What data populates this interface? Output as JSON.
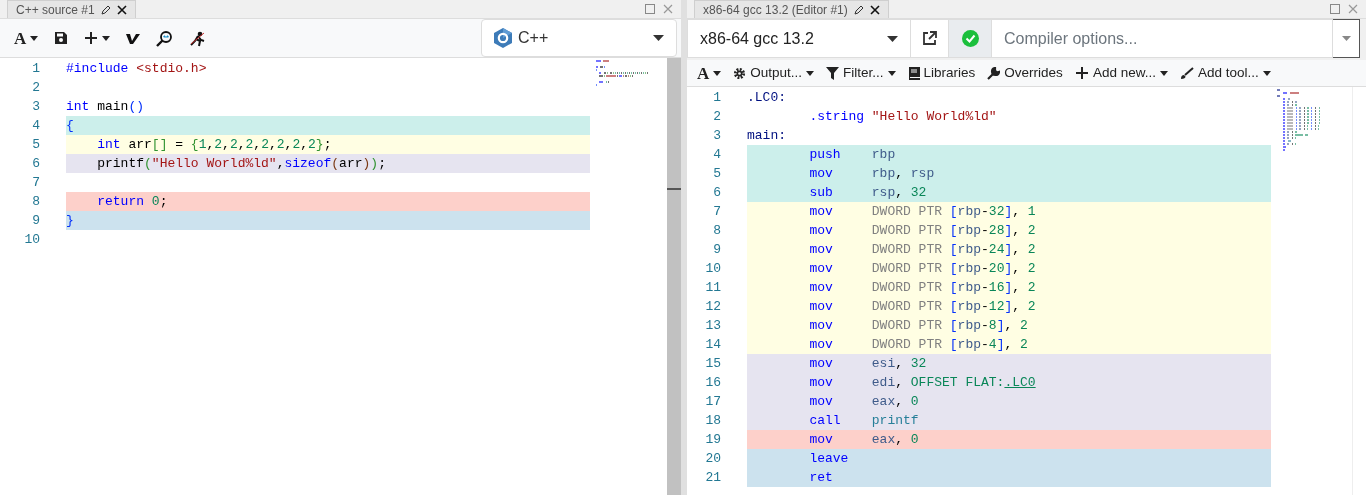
{
  "source_pane": {
    "tab": {
      "title": "C++ source #1"
    },
    "toolbar": [
      {
        "kind": "font",
        "label": "A",
        "dropdown": true
      },
      {
        "kind": "save",
        "dropdown": false
      },
      {
        "kind": "plus",
        "dropdown": true
      },
      {
        "kind": "vim",
        "dropdown": false
      },
      {
        "kind": "zoom",
        "dropdown": false
      },
      {
        "kind": "runner",
        "dropdown": false
      }
    ],
    "language": "C++",
    "code": [
      {
        "number": "1",
        "tokens": [
          {
            "text": "#include",
            "kind": "kw"
          },
          {
            "text": " <stdio.h>",
            "kind": "str"
          }
        ]
      },
      {
        "number": "2"
      },
      {
        "number": "3",
        "tokens": [
          {
            "text": "int",
            "kind": "kw"
          },
          {
            "text": " main",
            "kind": "plain"
          },
          {
            "text": "()",
            "kind": "b1"
          }
        ]
      },
      {
        "number": "4",
        "color": "#ccefeb",
        "tokens": [
          {
            "text": "{",
            "kind": "b1"
          }
        ]
      },
      {
        "number": "5",
        "color": "#fffee3",
        "tokens": [
          {
            "text": "    int",
            "kind": "kw"
          },
          {
            "text": " arr",
            "kind": "plain"
          },
          {
            "text": "[]",
            "kind": "b2"
          },
          {
            "text": " = ",
            "kind": "plain"
          },
          {
            "text": "{",
            "kind": "b2"
          },
          {
            "text": "1",
            "kind": "num"
          },
          {
            "text": ",",
            "kind": "plain"
          },
          {
            "text": "2",
            "kind": "num"
          },
          {
            "text": ",",
            "kind": "plain"
          },
          {
            "text": "2",
            "kind": "num"
          },
          {
            "text": ",",
            "kind": "plain"
          },
          {
            "text": "2",
            "kind": "num"
          },
          {
            "text": ",",
            "kind": "plain"
          },
          {
            "text": "2",
            "kind": "num"
          },
          {
            "text": ",",
            "kind": "plain"
          },
          {
            "text": "2",
            "kind": "num"
          },
          {
            "text": ",",
            "kind": "plain"
          },
          {
            "text": "2",
            "kind": "num"
          },
          {
            "text": ",",
            "kind": "plain"
          },
          {
            "text": "2",
            "kind": "num"
          },
          {
            "text": "}",
            "kind": "b2"
          },
          {
            "text": ";",
            "kind": "plain"
          }
        ]
      },
      {
        "number": "6",
        "color": "#e6e4f0",
        "tokens": [
          {
            "text": "    printf",
            "kind": "plain"
          },
          {
            "text": "(",
            "kind": "b2"
          },
          {
            "text": "\"Hello World%ld\"",
            "kind": "str"
          },
          {
            "text": ",",
            "kind": "plain"
          },
          {
            "text": "sizeof",
            "kind": "kw"
          },
          {
            "text": "(",
            "kind": "b3"
          },
          {
            "text": "arr",
            "kind": "plain"
          },
          {
            "text": ")",
            "kind": "b3"
          },
          {
            "text": ")",
            "kind": "b2"
          },
          {
            "text": ";",
            "kind": "plain"
          }
        ]
      },
      {
        "number": "7"
      },
      {
        "number": "8",
        "color": "#fdd0ca",
        "tokens": [
          {
            "text": "    return",
            "kind": "kw"
          },
          {
            "text": " 0",
            "kind": "num"
          },
          {
            "text": ";",
            "kind": "plain"
          }
        ]
      },
      {
        "number": "9",
        "color": "#cce2ee",
        "tokens": [
          {
            "text": "}",
            "kind": "b1"
          }
        ]
      },
      {
        "number": "10"
      }
    ]
  },
  "compiler_pane": {
    "tab": {
      "title": "x86-64 gcc 13.2 (Editor #1)"
    },
    "compiler": "x86-64 gcc 13.2",
    "options": {
      "placeholder": "Compiler options..."
    },
    "toolbar": [
      {
        "kind": "font",
        "label": "A",
        "dropdown": true
      },
      {
        "kind": "gear",
        "label": "Output...",
        "dropdown": true
      },
      {
        "kind": "filter",
        "label": "Filter...",
        "dropdown": true
      },
      {
        "kind": "book",
        "label": "Libraries",
        "dropdown": false
      },
      {
        "kind": "wrench",
        "label": "Overrides",
        "dropdown": false
      },
      {
        "kind": "plus",
        "label": "Add new...",
        "dropdown": true
      },
      {
        "kind": "brush",
        "label": "Add tool...",
        "dropdown": true
      }
    ],
    "code": [
      {
        "number": "1",
        "label": ".LC0:"
      },
      {
        "number": "2",
        "mnemonic": ".string",
        "operands": [
          {
            "text": "\"Hello World%ld\"",
            "kind": "str"
          }
        ]
      },
      {
        "number": "3",
        "label": "main:"
      },
      {
        "number": "4",
        "color": "#ccefeb",
        "mnemonic": "push",
        "operands": [
          {
            "text": "rbp",
            "kind": "reg"
          }
        ]
      },
      {
        "number": "5",
        "color": "#ccefeb",
        "mnemonic": "mov",
        "operands": [
          {
            "text": "rbp",
            "kind": "reg"
          },
          {
            "text": ", ",
            "kind": "plain"
          },
          {
            "text": "rsp",
            "kind": "reg"
          }
        ]
      },
      {
        "number": "6",
        "color": "#ccefeb",
        "mnemonic": "sub",
        "operands": [
          {
            "text": "rsp",
            "kind": "reg"
          },
          {
            "text": ", ",
            "kind": "plain"
          },
          {
            "text": "32",
            "kind": "num"
          }
        ]
      },
      {
        "number": "7",
        "color": "#fffee3",
        "mnemonic": "mov",
        "operands": [
          {
            "text": "DWORD PTR ",
            "kind": "ptr"
          },
          {
            "text": "[",
            "kind": "b1"
          },
          {
            "text": "rbp",
            "kind": "reg"
          },
          {
            "text": "-",
            "kind": "plain"
          },
          {
            "text": "32",
            "kind": "num"
          },
          {
            "text": "]",
            "kind": "b1"
          },
          {
            "text": ", ",
            "kind": "plain"
          },
          {
            "text": "1",
            "kind": "num"
          }
        ]
      },
      {
        "number": "8",
        "color": "#fffee3",
        "mnemonic": "mov",
        "operands": [
          {
            "text": "DWORD PTR ",
            "kind": "ptr"
          },
          {
            "text": "[",
            "kind": "b1"
          },
          {
            "text": "rbp",
            "kind": "reg"
          },
          {
            "text": "-",
            "kind": "plain"
          },
          {
            "text": "28",
            "kind": "num"
          },
          {
            "text": "]",
            "kind": "b1"
          },
          {
            "text": ", ",
            "kind": "plain"
          },
          {
            "text": "2",
            "kind": "num"
          }
        ]
      },
      {
        "number": "9",
        "color": "#fffee3",
        "mnemonic": "mov",
        "operands": [
          {
            "text": "DWORD PTR ",
            "kind": "ptr"
          },
          {
            "text": "[",
            "kind": "b1"
          },
          {
            "text": "rbp",
            "kind": "reg"
          },
          {
            "text": "-",
            "kind": "plain"
          },
          {
            "text": "24",
            "kind": "num"
          },
          {
            "text": "]",
            "kind": "b1"
          },
          {
            "text": ", ",
            "kind": "plain"
          },
          {
            "text": "2",
            "kind": "num"
          }
        ]
      },
      {
        "number": "10",
        "color": "#fffee3",
        "mnemonic": "mov",
        "operands": [
          {
            "text": "DWORD PTR ",
            "kind": "ptr"
          },
          {
            "text": "[",
            "kind": "b1"
          },
          {
            "text": "rbp",
            "kind": "reg"
          },
          {
            "text": "-",
            "kind": "plain"
          },
          {
            "text": "20",
            "kind": "num"
          },
          {
            "text": "]",
            "kind": "b1"
          },
          {
            "text": ", ",
            "kind": "plain"
          },
          {
            "text": "2",
            "kind": "num"
          }
        ]
      },
      {
        "number": "11",
        "color": "#fffee3",
        "mnemonic": "mov",
        "operands": [
          {
            "text": "DWORD PTR ",
            "kind": "ptr"
          },
          {
            "text": "[",
            "kind": "b1"
          },
          {
            "text": "rbp",
            "kind": "reg"
          },
          {
            "text": "-",
            "kind": "plain"
          },
          {
            "text": "16",
            "kind": "num"
          },
          {
            "text": "]",
            "kind": "b1"
          },
          {
            "text": ", ",
            "kind": "plain"
          },
          {
            "text": "2",
            "kind": "num"
          }
        ]
      },
      {
        "number": "12",
        "color": "#fffee3",
        "mnemonic": "mov",
        "operands": [
          {
            "text": "DWORD PTR ",
            "kind": "ptr"
          },
          {
            "text": "[",
            "kind": "b1"
          },
          {
            "text": "rbp",
            "kind": "reg"
          },
          {
            "text": "-",
            "kind": "plain"
          },
          {
            "text": "12",
            "kind": "num"
          },
          {
            "text": "]",
            "kind": "b1"
          },
          {
            "text": ", ",
            "kind": "plain"
          },
          {
            "text": "2",
            "kind": "num"
          }
        ]
      },
      {
        "number": "13",
        "color": "#fffee3",
        "mnemonic": "mov",
        "operands": [
          {
            "text": "DWORD PTR ",
            "kind": "ptr"
          },
          {
            "text": "[",
            "kind": "b1"
          },
          {
            "text": "rbp",
            "kind": "reg"
          },
          {
            "text": "-",
            "kind": "plain"
          },
          {
            "text": "8",
            "kind": "num"
          },
          {
            "text": "]",
            "kind": "b1"
          },
          {
            "text": ", ",
            "kind": "plain"
          },
          {
            "text": "2",
            "kind": "num"
          }
        ]
      },
      {
        "number": "14",
        "color": "#fffee3",
        "mnemonic": "mov",
        "operands": [
          {
            "text": "DWORD PTR ",
            "kind": "ptr"
          },
          {
            "text": "[",
            "kind": "b1"
          },
          {
            "text": "rbp",
            "kind": "reg"
          },
          {
            "text": "-",
            "kind": "plain"
          },
          {
            "text": "4",
            "kind": "num"
          },
          {
            "text": "]",
            "kind": "b1"
          },
          {
            "text": ", ",
            "kind": "plain"
          },
          {
            "text": "2",
            "kind": "num"
          }
        ]
      },
      {
        "number": "15",
        "color": "#e6e4f0",
        "mnemonic": "mov",
        "operands": [
          {
            "text": "esi",
            "kind": "reg"
          },
          {
            "text": ", ",
            "kind": "plain"
          },
          {
            "text": "32",
            "kind": "num"
          }
        ]
      },
      {
        "number": "16",
        "color": "#e6e4f0",
        "mnemonic": "mov",
        "operands": [
          {
            "text": "edi",
            "kind": "reg"
          },
          {
            "text": ", ",
            "kind": "plain"
          },
          {
            "text": "OFFSET FLAT:",
            "kind": "num"
          },
          {
            "text": ".LC0",
            "kind": "link"
          }
        ]
      },
      {
        "number": "17",
        "color": "#e6e4f0",
        "mnemonic": "mov",
        "operands": [
          {
            "text": "eax",
            "kind": "reg"
          },
          {
            "text": ", ",
            "kind": "plain"
          },
          {
            "text": "0",
            "kind": "num"
          }
        ]
      },
      {
        "number": "18",
        "color": "#e6e4f0",
        "mnemonic": "call",
        "operands": [
          {
            "text": "printf",
            "kind": "sym"
          }
        ]
      },
      {
        "number": "19",
        "color": "#fdd0ca",
        "mnemonic": "mov",
        "operands": [
          {
            "text": "eax",
            "kind": "reg"
          },
          {
            "text": ", ",
            "kind": "plain"
          },
          {
            "text": "0",
            "kind": "num"
          }
        ]
      },
      {
        "number": "20",
        "color": "#cce2ee",
        "mnemonic": "leave"
      },
      {
        "number": "21",
        "color": "#cce2ee",
        "mnemonic": "ret"
      }
    ]
  }
}
